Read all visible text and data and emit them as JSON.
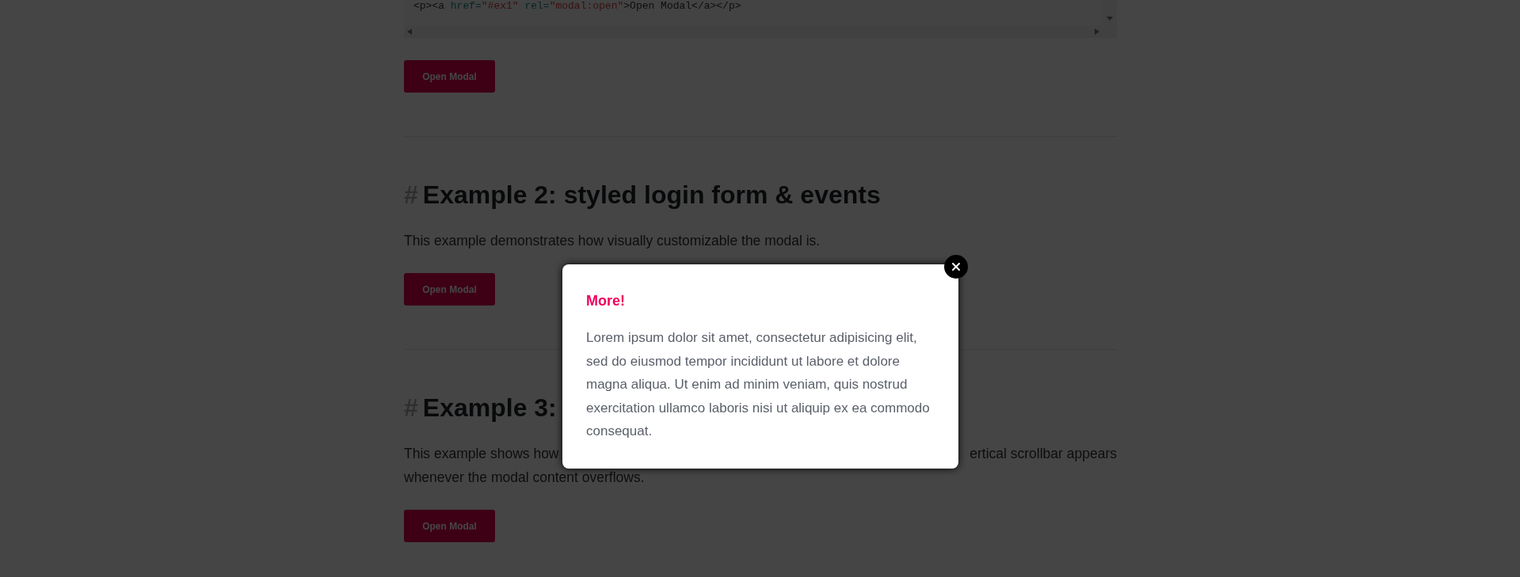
{
  "code_block": {
    "tokens": [
      {
        "text": "<p><a ",
        "kind": "tag"
      },
      {
        "text": "href=",
        "kind": "attr"
      },
      {
        "text": "\"#ex1\"",
        "kind": "string"
      },
      {
        "text": " rel=",
        "kind": "attr"
      },
      {
        "text": "\"modal:open\"",
        "kind": "string"
      },
      {
        "text": ">",
        "kind": "tag"
      },
      {
        "text": "Open Modal",
        "kind": "text"
      },
      {
        "text": "</a></p>",
        "kind": "tag"
      }
    ]
  },
  "sections": [
    {
      "button": "Open Modal"
    },
    {
      "heading_mark": "#",
      "heading": "Example 2: styled login form & events",
      "paragraph_lines": [
        [
          "This example demonstrates how visually customizable the modal is."
        ]
      ],
      "button": "Open Modal"
    },
    {
      "heading_mark": "#",
      "heading": "Example 3:",
      "paragraph_lines": [
        [
          "This example shows how",
          "ertical scrollbar appears"
        ],
        [
          "whenever the modal content overflows."
        ]
      ],
      "button": "Open Modal"
    }
  ],
  "modal": {
    "title": "More!",
    "body": "Lorem ipsum dolor sit amet, consectetur adipisicing elit, sed do eiusmod tempor incididunt ut labore et dolore magna aliqua. Ut enim ad minim veniam, quis nostrud exercitation ullamco laboris nisi ut aliquip ex ea commodo consequat."
  }
}
